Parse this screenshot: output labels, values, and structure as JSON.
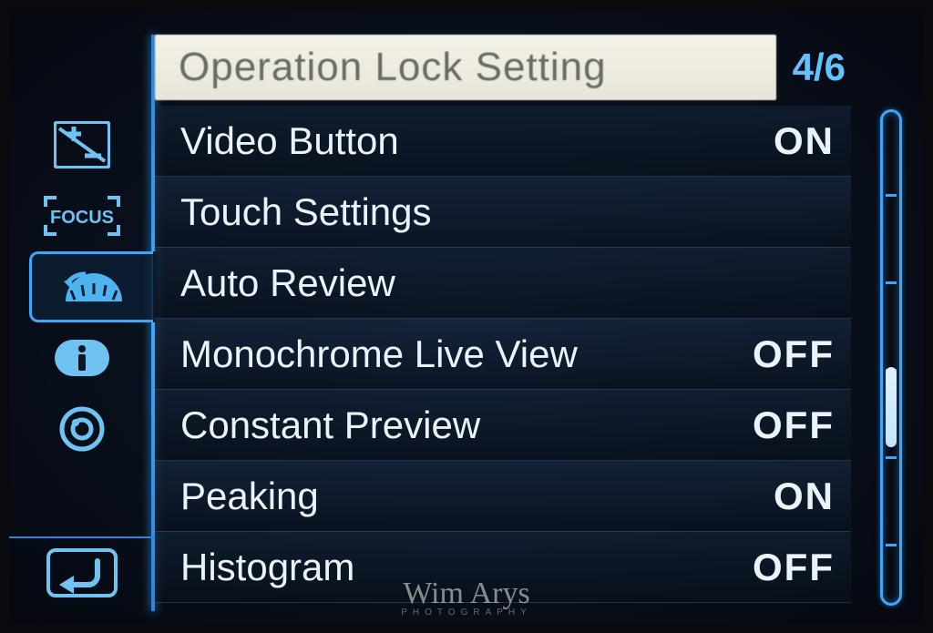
{
  "header": {
    "title": "Operation Lock Setting",
    "page_current": 4,
    "page_total": 6,
    "page_indicator": "4/6"
  },
  "sidebar": {
    "categories": [
      {
        "id": "exposure-comp",
        "icon": "exposure-comp-icon",
        "selected": false
      },
      {
        "id": "focus",
        "icon": "focus-icon",
        "selected": false
      },
      {
        "id": "dial",
        "icon": "dial-icon",
        "selected": true
      },
      {
        "id": "info",
        "icon": "info-icon",
        "selected": false
      },
      {
        "id": "lens",
        "icon": "lens-icon",
        "selected": false
      }
    ],
    "back_label": "back-icon"
  },
  "menu": {
    "items": [
      {
        "label": "Video Button",
        "value": "ON"
      },
      {
        "label": "Touch Settings",
        "value": ""
      },
      {
        "label": "Auto Review",
        "value": ""
      },
      {
        "label": "Monochrome Live View",
        "value": "OFF"
      },
      {
        "label": "Constant Preview",
        "value": "OFF"
      },
      {
        "label": "Peaking",
        "value": "ON"
      },
      {
        "label": "Histogram",
        "value": "OFF"
      }
    ]
  },
  "scrollbar": {
    "ticks": 5,
    "thumb_position_percent": 50
  },
  "watermark": {
    "name": "Wim Arys",
    "sub": "PHOTOGRAPHY"
  }
}
